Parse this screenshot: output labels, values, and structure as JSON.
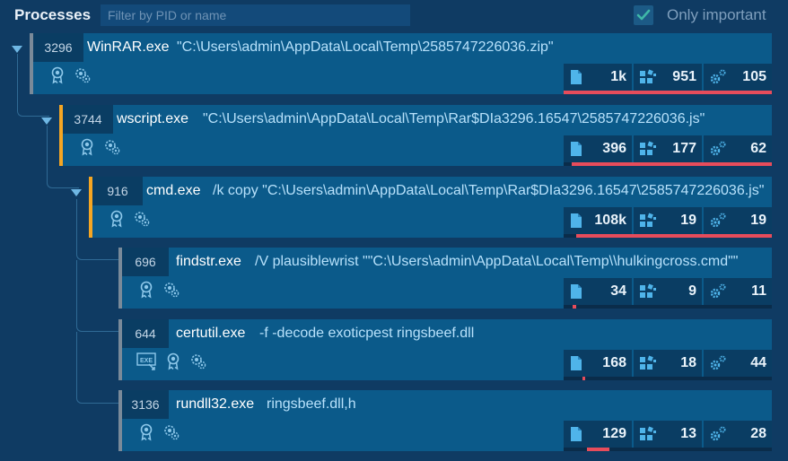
{
  "header": {
    "title": "Processes",
    "filter_placeholder": "Filter by PID or name",
    "only_important_label": "Only important",
    "only_important_checked": true
  },
  "colors": {
    "background": "#0f3b63",
    "card": "#0b5a8a",
    "accent_orange": "#f5a623",
    "accent_gray": "#7a8a99",
    "bar": "#e74c5b"
  },
  "processes": [
    {
      "pid": "3296",
      "name": "WinRAR.exe",
      "cmd": "\"C:\\Users\\admin\\AppData\\Local\\Temp\\2585747226036.zip\"",
      "accent": "gray",
      "expanded": true,
      "icons": [
        "certificate-icon",
        "gear-cog-icon"
      ],
      "stats": {
        "files": "1k",
        "registry": "951",
        "modules": "105"
      },
      "bar": {
        "start": 0.0,
        "end": 1.0
      }
    },
    {
      "pid": "3744",
      "name": "wscript.exe",
      "cmd": "\"C:\\Users\\admin\\AppData\\Local\\Temp\\Rar$DIa3296.16547\\2585747226036.js\"",
      "accent": "orange",
      "expanded": true,
      "icons": [
        "certificate-icon",
        "gear-cog-icon"
      ],
      "stats": {
        "files": "396",
        "registry": "177",
        "modules": "62"
      },
      "bar": {
        "start": 0.04,
        "end": 1.0
      }
    },
    {
      "pid": "916",
      "name": "cmd.exe",
      "cmd": "/k copy \"C:\\Users\\admin\\AppData\\Local\\Temp\\Rar$DIa3296.16547\\2585747226036.js\"",
      "accent": "orange",
      "expanded": true,
      "icons": [
        "certificate-icon",
        "gear-cog-icon"
      ],
      "stats": {
        "files": "108k",
        "registry": "19",
        "modules": "19"
      },
      "bar": {
        "start": 0.06,
        "end": 1.0
      }
    },
    {
      "pid": "696",
      "name": "findstr.exe",
      "cmd": "/V plausiblewrist \"\"C:\\Users\\admin\\AppData\\Local\\Temp\\\\hulkingcross.cmd\"\"",
      "accent": "gray",
      "expanded": false,
      "icons": [
        "certificate-icon",
        "gear-cog-icon"
      ],
      "stats": {
        "files": "34",
        "registry": "9",
        "modules": "11"
      },
      "bar": {
        "start": 0.045,
        "end": 0.06
      }
    },
    {
      "pid": "644",
      "name": "certutil.exe",
      "cmd": "-f -decode exoticpest ringsbeef.dll",
      "accent": "gray",
      "expanded": false,
      "icons": [
        "exe-file-icon",
        "certificate-icon",
        "gear-cog-icon"
      ],
      "stats": {
        "files": "168",
        "registry": "18",
        "modules": "44"
      },
      "bar": {
        "start": 0.09,
        "end": 0.105
      }
    },
    {
      "pid": "3136",
      "name": "rundll32.exe",
      "cmd": "ringsbeef.dll,h",
      "accent": "gray",
      "expanded": false,
      "icons": [
        "certificate-icon",
        "gear-cog-icon"
      ],
      "stats": {
        "files": "129",
        "registry": "13",
        "modules": "28"
      },
      "bar": {
        "start": 0.11,
        "end": 0.22
      }
    }
  ]
}
